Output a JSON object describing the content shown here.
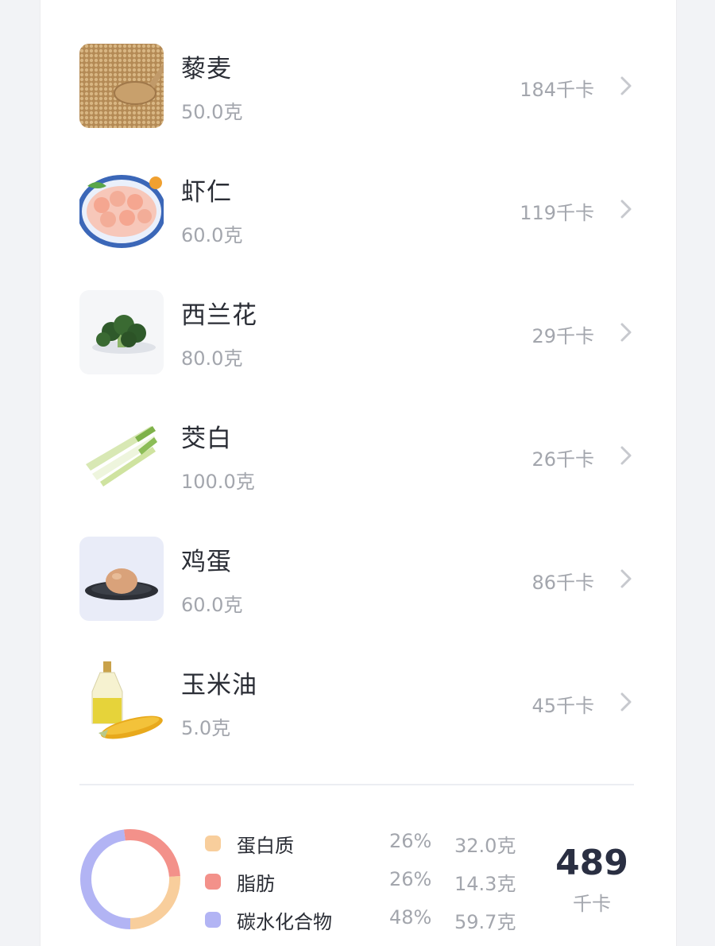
{
  "foods": [
    {
      "name": "藜麦",
      "weight": "50.0克",
      "kcal": "184千卡",
      "image": "quinoa-image"
    },
    {
      "name": "虾仁",
      "weight": "60.0克",
      "kcal": "119千卡",
      "image": "shrimp-image"
    },
    {
      "name": "西兰花",
      "weight": "80.0克",
      "kcal": "29千卡",
      "image": "broccoli-image"
    },
    {
      "name": "茭白",
      "weight": "100.0克",
      "kcal": "26千卡",
      "image": "water-bamboo-image"
    },
    {
      "name": "鸡蛋",
      "weight": "60.0克",
      "kcal": "86千卡",
      "image": "egg-image"
    },
    {
      "name": "玉米油",
      "weight": "5.0克",
      "kcal": "45千卡",
      "image": "corn-oil-image"
    }
  ],
  "summary": {
    "macros": [
      {
        "label": "蛋白质",
        "percent": "26%",
        "grams": "32.0克",
        "share": 0.26,
        "color": "#f8ce9c"
      },
      {
        "label": "脂肪",
        "percent": "26%",
        "grams": "14.3克",
        "share": 0.26,
        "color": "#f3918a"
      },
      {
        "label": "碳水化合物",
        "percent": "48%",
        "grams": "59.7克",
        "share": 0.48,
        "color": "#b2b4f4"
      }
    ],
    "total_kcal": "489",
    "total_unit": "千卡"
  },
  "colors": {
    "text_primary": "#2a2d35",
    "text_secondary": "#a3a6ad",
    "chevron": "#c7c9ce"
  },
  "icons": {
    "row_arrow": "chevron-right-icon"
  }
}
